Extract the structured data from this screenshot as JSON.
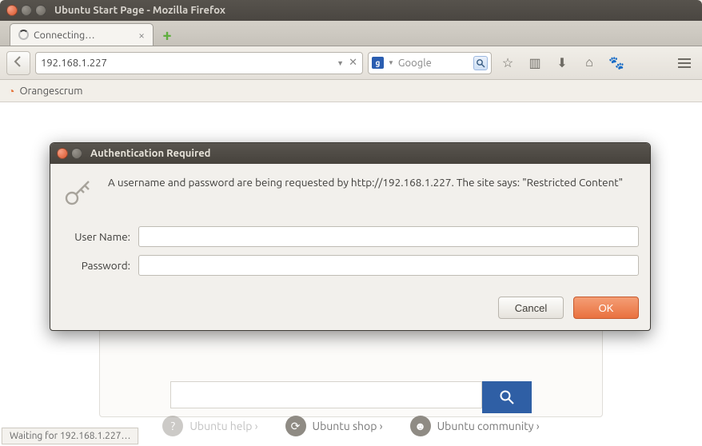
{
  "window": {
    "title": "Ubuntu Start Page - Mozilla Firefox"
  },
  "tab": {
    "label": "Connecting…"
  },
  "url": {
    "value": "192.168.1.227"
  },
  "search": {
    "engine_glyph": "g",
    "placeholder": "Google"
  },
  "bookmark": {
    "label": "Orangescrum"
  },
  "footer": {
    "help": {
      "label": "Ubuntu help ›"
    },
    "shop": {
      "label": "Ubuntu shop ›"
    },
    "community": {
      "label": "Ubuntu community ›"
    }
  },
  "status": {
    "text": "Waiting for 192.168.1.227…"
  },
  "dialog": {
    "title": "Authentication Required",
    "message": "A username and password are being requested by http://192.168.1.227. The site says: \"Restricted Content\"",
    "username_label": "User Name:",
    "password_label": "Password:",
    "username_value": "",
    "password_value": "",
    "cancel": "Cancel",
    "ok": "OK"
  }
}
